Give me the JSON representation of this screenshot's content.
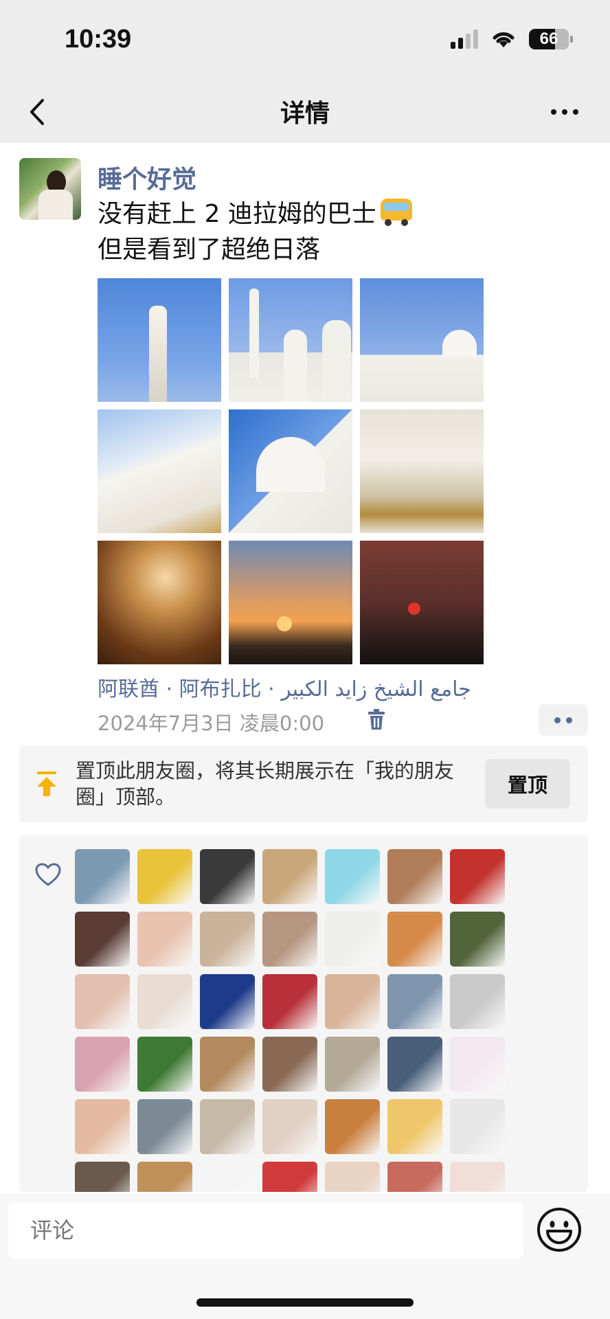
{
  "status_bar": {
    "time": "10:39",
    "battery": "66"
  },
  "nav": {
    "title": "详情"
  },
  "post": {
    "username": "睡个好觉",
    "text_line1": "没有赶上 2 迪拉姆的巴士",
    "text_line2": "但是看到了超绝日落",
    "emoji": "bus",
    "photos": [
      "mosque-minaret",
      "mosque-front",
      "mosque-dome",
      "mosque-arcade",
      "mosque-arch-dome",
      "mosque-corridor",
      "mosque-interior",
      "mosque-sunset",
      "sunset-palms"
    ],
    "location": "阿联酋 · 阿布扎比 · جامع الشيخ زايد الكبير",
    "timestamp": "2024年7月3日 凌晨0:00"
  },
  "pin": {
    "text": "置顶此朋友圈，将其长期展示在「我的朋友圈」顶部。",
    "button_label": "置顶"
  },
  "likes": {
    "liker_colors": [
      "#7d9ab3",
      "#e9c33a",
      "#3a3a3a",
      "#c9a77a",
      "#8fd7e6",
      "#b07d58",
      "#c4322d",
      "#5a3c35",
      "#e8c3b0",
      "#c9b39a",
      "#b59680",
      "#eeeeea",
      "#d68a4a",
      "#51643a",
      "#e2bfae",
      "#e9dcd2",
      "#1e3a8a",
      "#b8303a",
      "#d8b59a",
      "#7e95ad",
      "#c9c9c9",
      "#d9a2b0",
      "#3d7a33",
      "#b28a5e",
      "#8a6a55",
      "#b4a896",
      "#4a5f7a",
      "#f3e8f0",
      "#e4b9a1",
      "#7c8a96",
      "#c7b9a8",
      "#e1d0c4",
      "#c9803f",
      "#f0c66a",
      "#e7e7e7",
      "#6b5a4c",
      "#c08f5a",
      "#f5f5f5",
      "#d13a3a",
      "#e9d3c3",
      "#c76b5e",
      "#f1ded8"
    ]
  },
  "comment": {
    "placeholder": "评论"
  }
}
